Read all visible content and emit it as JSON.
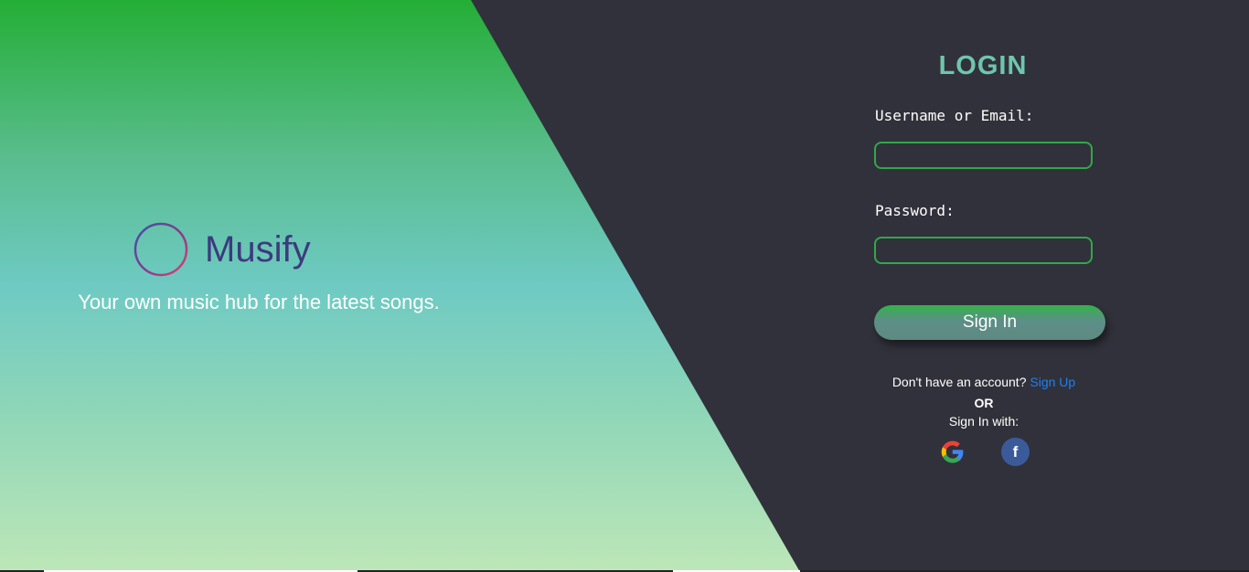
{
  "brand": {
    "name": "Musify",
    "tagline": "Your own music hub for the latest songs.",
    "logo_icon": "soundwave-circle-icon"
  },
  "login": {
    "title": "LOGIN",
    "username_label": "Username or Email:",
    "username_value": "",
    "password_label": "Password:",
    "password_value": "",
    "submit_label": "Sign In",
    "no_account_text": "Don't have an account?",
    "signup_label": "Sign Up",
    "or_text": "OR",
    "signin_with_text": "Sign In with:",
    "social": [
      {
        "name": "google",
        "icon": "google-icon"
      },
      {
        "name": "facebook",
        "icon": "facebook-icon",
        "glyph": "f"
      }
    ]
  },
  "colors": {
    "panel_background": "#31313b",
    "accent_green": "#31a84a",
    "title_teal": "#6ec6ad",
    "brand_text": "#3d3a7e",
    "link_blue": "#1f7ff0",
    "facebook_blue": "#3b5a9a"
  }
}
